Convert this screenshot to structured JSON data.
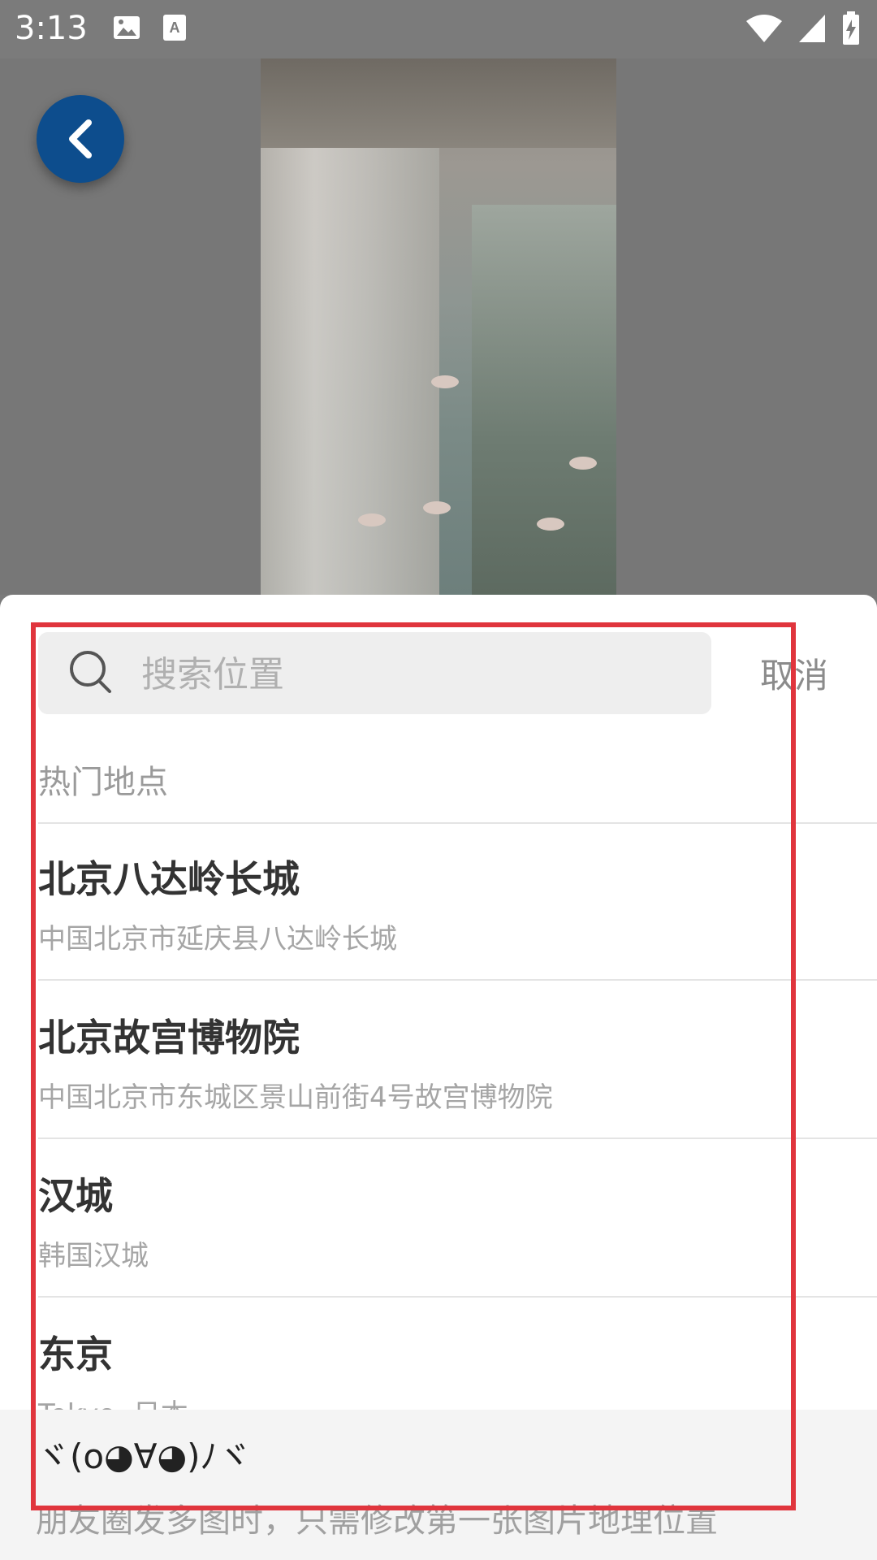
{
  "status_bar": {
    "time": "3:13",
    "icons_left": [
      "image-icon",
      "text-a-icon"
    ],
    "icons_right": [
      "wifi-icon",
      "signal-icon",
      "battery-charging-icon"
    ]
  },
  "background": {
    "back_button_icon": "chevron-left-icon",
    "accent_color": "#0d4d8d"
  },
  "sheet": {
    "search": {
      "placeholder": "搜索位置",
      "value": ""
    },
    "cancel_label": "取消",
    "section_title": "热门地点",
    "places": [
      {
        "title": "北京八达岭长城",
        "subtitle": "中国北京市延庆县八达岭长城"
      },
      {
        "title": "北京故宫博物院",
        "subtitle": "中国北京市东城区景山前街4号故宫博物院"
      },
      {
        "title": "汉城",
        "subtitle": "韩国汉城"
      },
      {
        "title": "东京",
        "subtitle": "Tokyo, 日本"
      }
    ]
  },
  "footer": {
    "emoticon": "ヾ(o◕∀◕)ﾉヾ",
    "hint": "朋友圈发多图时，只需修改第一张图片地理位置"
  },
  "highlight_color": "#e0353d"
}
